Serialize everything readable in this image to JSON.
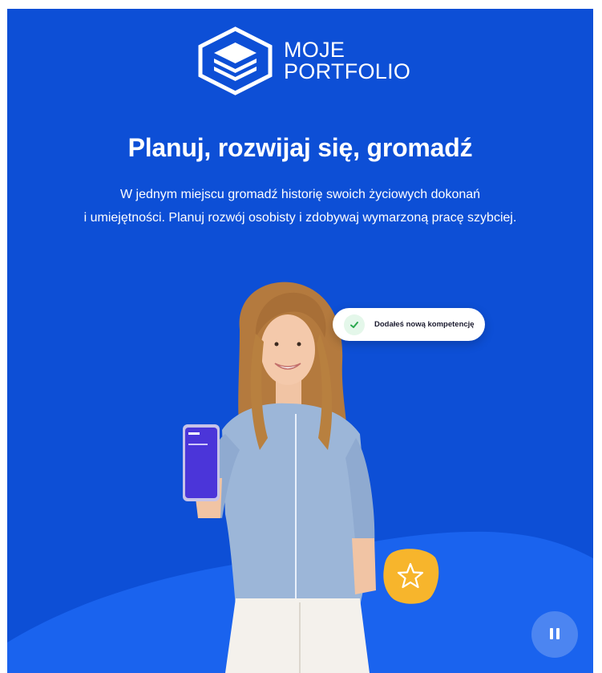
{
  "brand": {
    "line1": "MOJE",
    "line2": "PORTFOLIO"
  },
  "hero": {
    "title": "Planuj, rozwijaj się, gromadź",
    "subtitle_line1": "W jednym miejscu gromadź historię swoich życiowych dokonań",
    "subtitle_line2": "i umiejętności. Planuj rozwój osobisty i zdobywaj wymarzoną pracę szybciej."
  },
  "toast": {
    "message": "Dodałeś nową kompetencję"
  },
  "colors": {
    "background": "#0d4fd6",
    "wave": "#1a63ee",
    "accent_yellow": "#f7b52c",
    "success": "#2aa84e"
  },
  "icons": {
    "logo": "layers-hexagon-icon",
    "check": "check-icon",
    "star": "star-icon",
    "pause": "pause-icon"
  }
}
